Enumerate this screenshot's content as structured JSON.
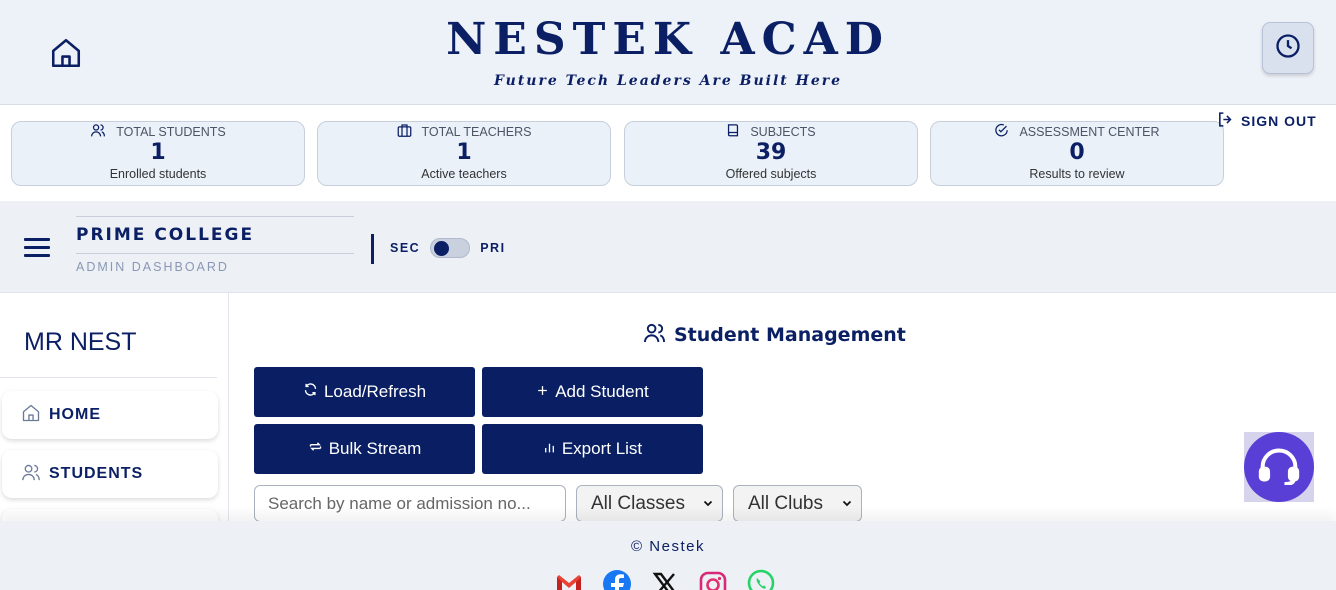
{
  "header": {
    "brand_title": "NESTEK ACAD",
    "brand_tagline": "Future Tech Leaders Are Built Here",
    "home_icon": "home-icon",
    "clock_icon": "clock-icon"
  },
  "stats": [
    {
      "label": "TOTAL STUDENTS",
      "value": "1",
      "sub": "Enrolled students",
      "icon": "users-icon"
    },
    {
      "label": "TOTAL TEACHERS",
      "value": "1",
      "sub": "Active teachers",
      "icon": "briefcase-icon"
    },
    {
      "label": "SUBJECTS",
      "value": "39",
      "sub": "Offered subjects",
      "icon": "book-icon"
    },
    {
      "label": "ASSESSMENT CENTER",
      "value": "0",
      "sub": "Results to review",
      "icon": "check-circle-icon"
    }
  ],
  "signout_label": "SIGN OUT",
  "college": {
    "name": "PRIME COLLEGE",
    "subtitle": "ADMIN DASHBOARD",
    "toggle_left": "SEC",
    "toggle_right": "PRI"
  },
  "sidebar": {
    "user_name": "MR NEST",
    "items": [
      {
        "label": "HOME",
        "icon": "home-icon"
      },
      {
        "label": "STUDENTS",
        "icon": "users-icon"
      }
    ]
  },
  "main": {
    "section_title": "Student Management",
    "buttons": {
      "load_refresh": "Load/Refresh",
      "add_student": "Add Student",
      "bulk_stream": "Bulk Stream",
      "export_list": "Export List"
    },
    "search_placeholder": "Search by name or admission no...",
    "class_filter": "All Classes",
    "club_filter": "All Clubs"
  },
  "footer": {
    "copyright": "© Nestek",
    "socials": [
      "gmail-icon",
      "facebook-icon",
      "x-icon",
      "instagram-icon",
      "whatsapp-icon"
    ]
  },
  "colors": {
    "primary": "#0a1f63",
    "header_bg": "#edf1f8",
    "stat_bg": "#eaf1f9",
    "support": "#5a3fd6"
  }
}
